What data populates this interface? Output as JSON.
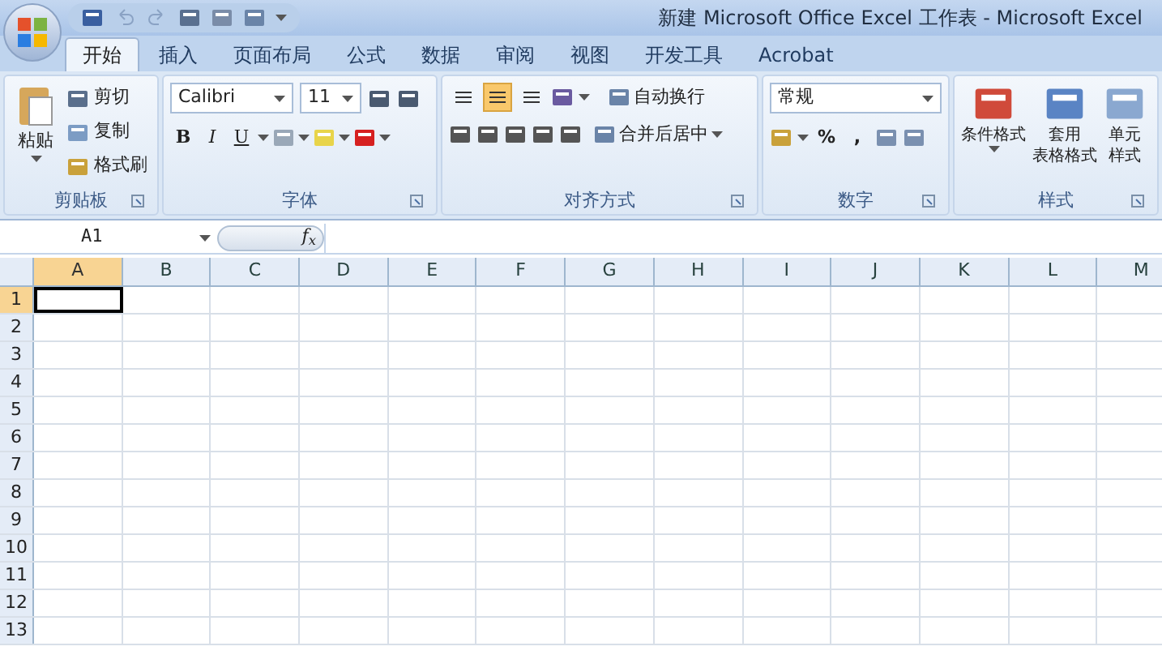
{
  "window": {
    "title": "新建 Microsoft Office Excel 工作表 - Microsoft Excel"
  },
  "tabs": [
    {
      "label": "开始",
      "selected": true
    },
    {
      "label": "插入",
      "selected": false
    },
    {
      "label": "页面布局",
      "selected": false
    },
    {
      "label": "公式",
      "selected": false
    },
    {
      "label": "数据",
      "selected": false
    },
    {
      "label": "审阅",
      "selected": false
    },
    {
      "label": "视图",
      "selected": false
    },
    {
      "label": "开发工具",
      "selected": false
    },
    {
      "label": "Acrobat",
      "selected": false
    }
  ],
  "ribbon": {
    "clipboard": {
      "paste": "粘贴",
      "items": [
        "剪切",
        "复制",
        "格式刷"
      ],
      "label": "剪贴板"
    },
    "font": {
      "name": "Calibri",
      "size": "11",
      "styles": [
        "B",
        "I",
        "U"
      ],
      "label": "字体"
    },
    "alignment": {
      "buttons": [
        {
          "selected": false
        },
        {
          "selected": true
        },
        {
          "selected": false
        }
      ],
      "wrap": "自动换行",
      "merge": "合并后居中",
      "label": "对齐方式"
    },
    "number": {
      "format": "常规",
      "symbols": [
        "%",
        ","
      ],
      "label": "数字"
    },
    "styles": {
      "items": [
        {
          "line1": "条件格式"
        },
        {
          "line1": "套用",
          "line2": "表格格式"
        },
        {
          "line1": "单元",
          "line2": "样式"
        }
      ],
      "label": "样式"
    }
  },
  "formula_bar": {
    "name_box": "A1",
    "fx": "f$_{x}$"
  },
  "sheet": {
    "columns": [
      {
        "label": "A",
        "selected": true
      },
      {
        "label": "B",
        "selected": false
      },
      {
        "label": "C",
        "selected": false
      },
      {
        "label": "D",
        "selected": false
      },
      {
        "label": "E",
        "selected": false
      },
      {
        "label": "F",
        "selected": false
      },
      {
        "label": "G",
        "selected": false
      },
      {
        "label": "H",
        "selected": false
      },
      {
        "label": "I",
        "selected": false
      },
      {
        "label": "J",
        "selected": false
      },
      {
        "label": "K",
        "selected": false
      },
      {
        "label": "L",
        "selected": false
      },
      {
        "label": "M",
        "selected": false
      }
    ],
    "rows": [
      {
        "label": "1",
        "selected": true
      },
      {
        "label": "2",
        "selected": false
      },
      {
        "label": "3",
        "selected": false
      },
      {
        "label": "4",
        "selected": false
      },
      {
        "label": "5",
        "selected": false
      },
      {
        "label": "6",
        "selected": false
      },
      {
        "label": "7",
        "selected": false
      },
      {
        "label": "8",
        "selected": false
      },
      {
        "label": "9",
        "selected": false
      },
      {
        "label": "10",
        "selected": false
      },
      {
        "label": "11",
        "selected": false
      },
      {
        "label": "12",
        "selected": false
      },
      {
        "label": "13",
        "selected": false
      }
    ]
  }
}
